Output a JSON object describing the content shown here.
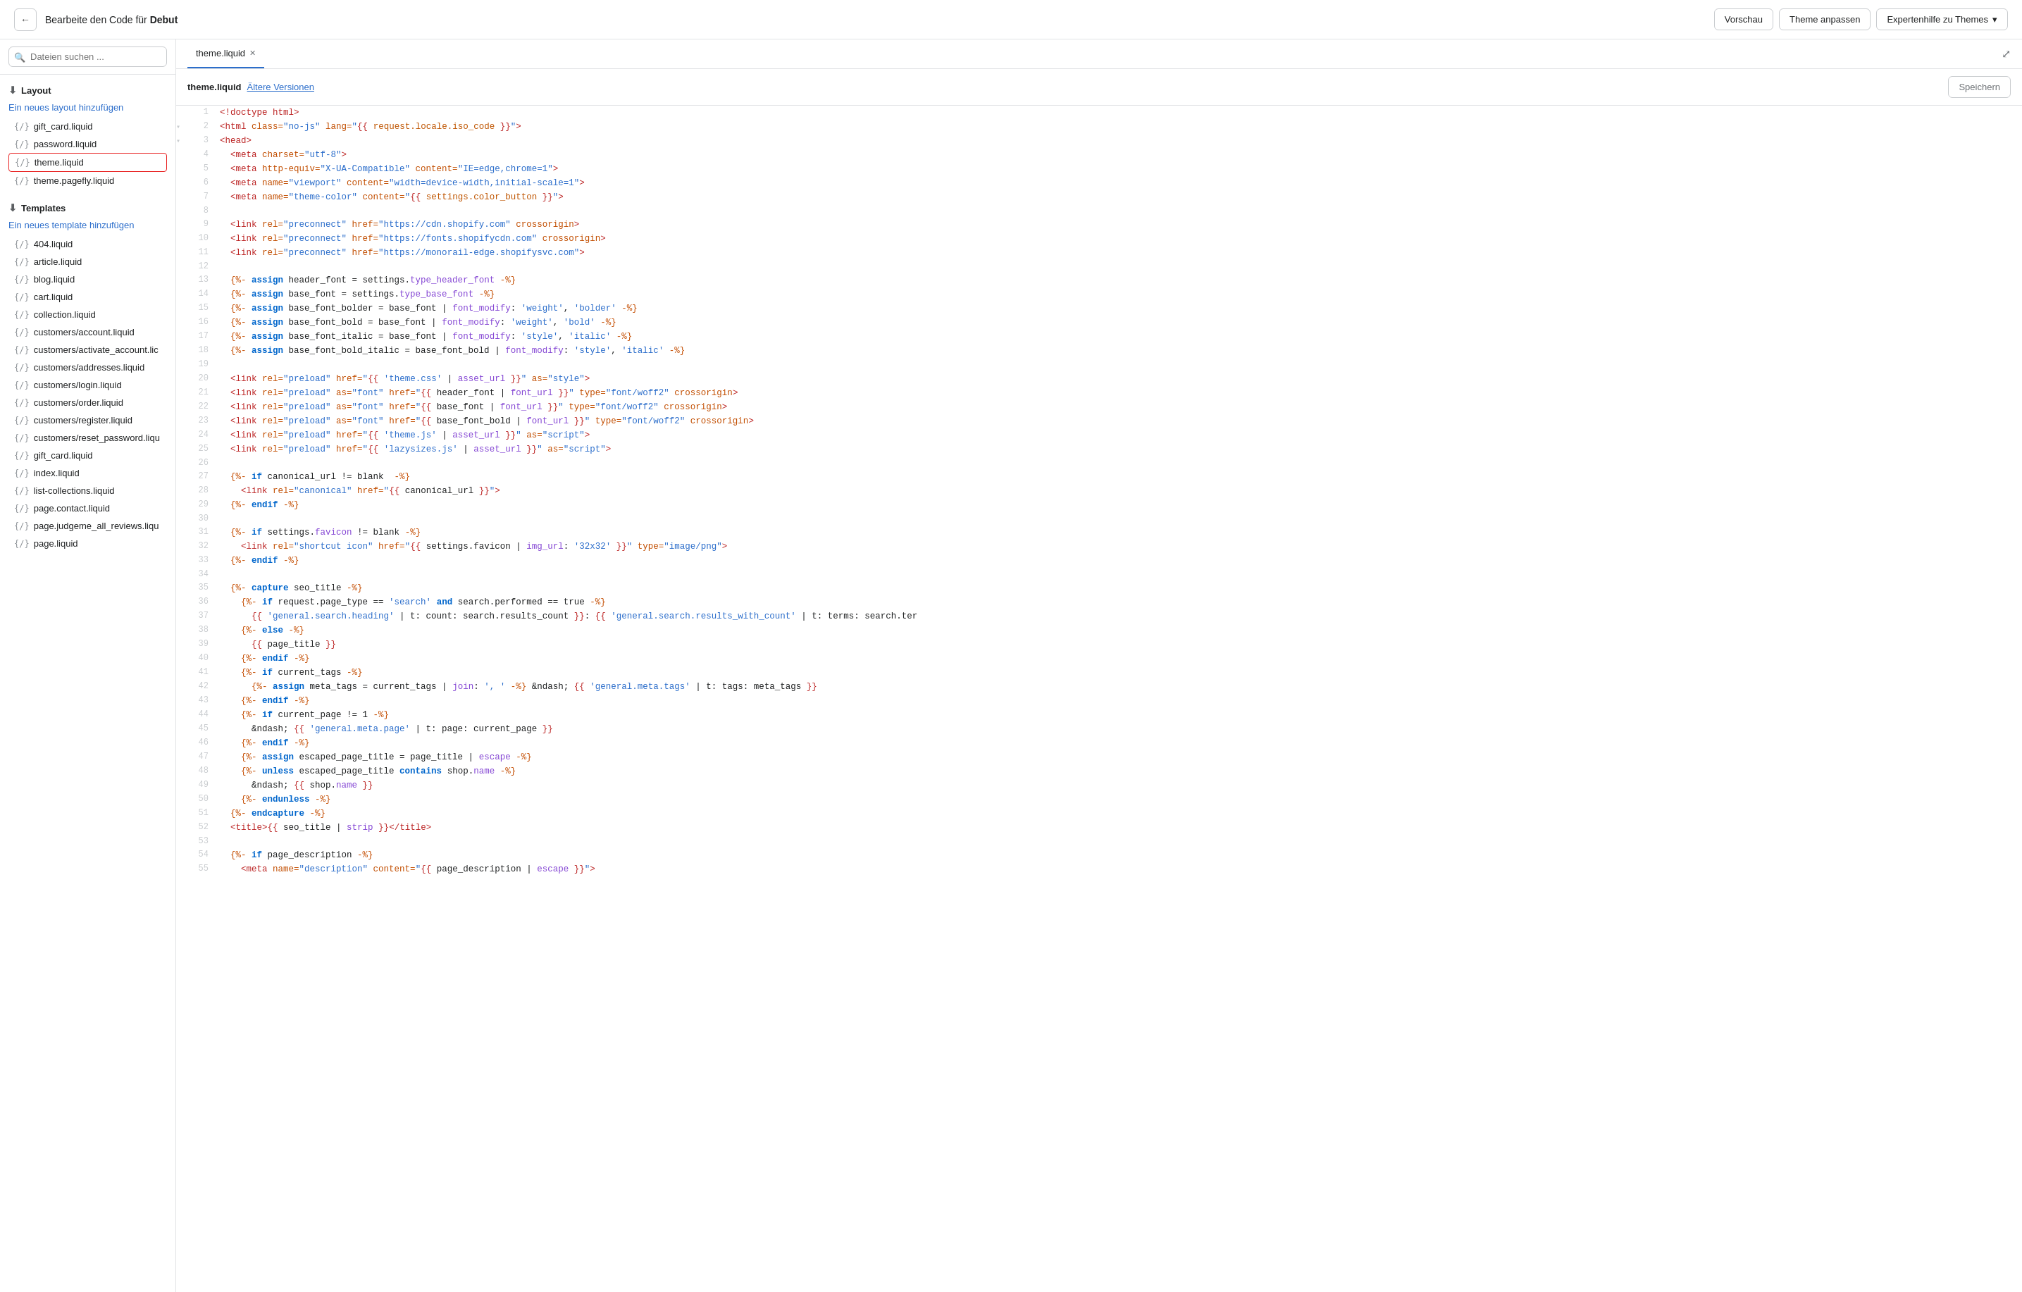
{
  "topbar": {
    "back_label": "←",
    "title_prefix": "Bearbeite den Code für ",
    "title_bold": "Debut",
    "btn_preview": "Vorschau",
    "btn_theme": "Theme anpassen",
    "btn_expert": "Expertenhilfe zu Themes",
    "btn_expert_arrow": "▾"
  },
  "sidebar": {
    "search_placeholder": "Dateien suchen ...",
    "layout_section": "Layout",
    "layout_add": "Ein neues layout hinzufügen",
    "layout_files": [
      "gift_card.liquid",
      "password.liquid",
      "theme.liquid",
      "theme.pagefly.liquid"
    ],
    "templates_section": "Templates",
    "templates_add": "Ein neues template hinzufügen",
    "template_files": [
      "404.liquid",
      "article.liquid",
      "blog.liquid",
      "cart.liquid",
      "collection.liquid",
      "customers/account.liquid",
      "customers/activate_account.lic",
      "customers/addresses.liquid",
      "customers/login.liquid",
      "customers/order.liquid",
      "customers/register.liquid",
      "customers/reset_password.liqu",
      "gift_card.liquid",
      "index.liquid",
      "list-collections.liquid",
      "page.contact.liquid",
      "page.judgeme_all_reviews.liqu",
      "page.liquid"
    ]
  },
  "tabs": [
    {
      "label": "theme.liquid",
      "active": true
    }
  ],
  "editor": {
    "filename": "theme.liquid",
    "versions": "Ältere Versionen",
    "save_btn": "Speichern"
  }
}
